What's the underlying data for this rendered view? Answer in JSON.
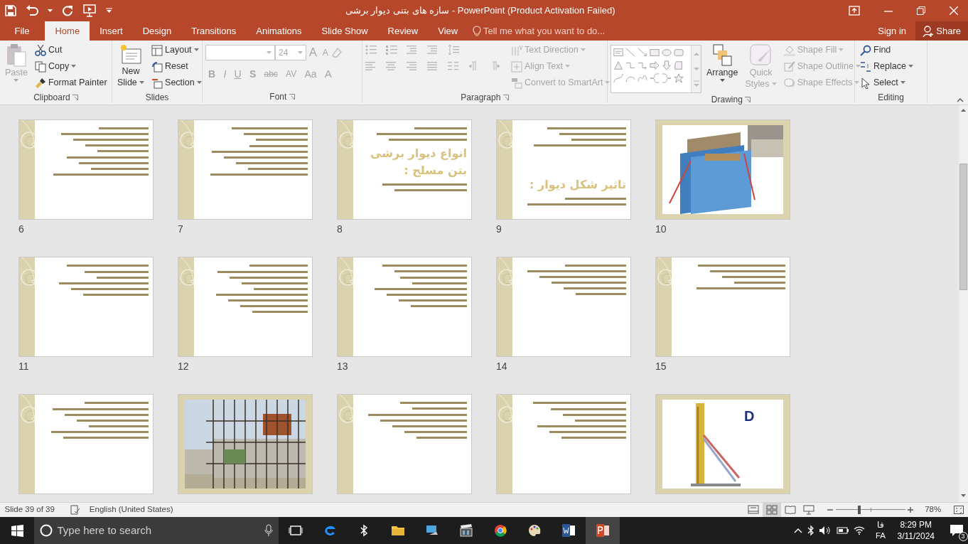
{
  "window": {
    "title": "سازه های بتنی دیوار برشی - PowerPoint (Product Activation Failed)"
  },
  "tabs": [
    {
      "label": "File",
      "selected": false
    },
    {
      "label": "Home",
      "selected": true
    },
    {
      "label": "Insert",
      "selected": false
    },
    {
      "label": "Design",
      "selected": false
    },
    {
      "label": "Transitions",
      "selected": false
    },
    {
      "label": "Animations",
      "selected": false
    },
    {
      "label": "Slide Show",
      "selected": false
    },
    {
      "label": "Review",
      "selected": false
    },
    {
      "label": "View",
      "selected": false
    }
  ],
  "tell_me": {
    "placeholder": "Tell me what you want to do..."
  },
  "account": {
    "sign_in": "Sign in",
    "share": "Share"
  },
  "ribbon": {
    "clipboard": {
      "label": "Clipboard",
      "paste": {
        "label": "Paste",
        "disabled": true
      },
      "items": [
        {
          "label": "Cut",
          "disabled": false
        },
        {
          "label": "Copy",
          "disabled": false
        },
        {
          "label": "Format Painter",
          "disabled": false
        }
      ]
    },
    "slides": {
      "label": "Slides",
      "new_slide": {
        "label": "New",
        "label_2": "Slide"
      },
      "items": [
        {
          "label": "Layout",
          "disabled": false
        },
        {
          "label": "Reset",
          "disabled": false
        },
        {
          "label": "Section",
          "disabled": false
        }
      ]
    },
    "font": {
      "label": "Font",
      "font_size": "24",
      "buttons": [
        "A",
        "A",
        "B",
        "I",
        "U",
        "S",
        "abc",
        "AV",
        "Aa",
        "A"
      ]
    },
    "paragraph": {
      "label": "Paragraph",
      "items": [
        {
          "label": "Text Direction",
          "disabled": true
        },
        {
          "label": "Align Text",
          "disabled": true
        },
        {
          "label": "Convert to SmartArt",
          "disabled": true
        }
      ]
    },
    "drawing": {
      "label": "Drawing",
      "arrange": {
        "label": "Arrange",
        "disabled": false
      },
      "quick_styles": {
        "label": "Quick",
        "label_2": "Styles",
        "disabled": true
      },
      "items": [
        {
          "label": "Shape Fill",
          "disabled": true
        },
        {
          "label": "Shape Outline",
          "disabled": true
        },
        {
          "label": "Shape Effects",
          "disabled": true
        }
      ]
    },
    "editing": {
      "label": "Editing",
      "items": [
        {
          "label": "Find",
          "disabled": false
        },
        {
          "label": "Replace",
          "disabled": false
        },
        {
          "label": "Select",
          "disabled": false
        }
      ]
    }
  },
  "slides": [
    {
      "number": "6",
      "kind": "text"
    },
    {
      "number": "7",
      "kind": "text"
    },
    {
      "number": "8",
      "kind": "text",
      "title": "انواع دیوار برشی بتن مسلح :"
    },
    {
      "number": "9",
      "kind": "text",
      "title": "تاثیر شکل دیوار :"
    },
    {
      "number": "10",
      "kind": "picture"
    },
    {
      "number": "11",
      "kind": "text"
    },
    {
      "number": "12",
      "kind": "text"
    },
    {
      "number": "13",
      "kind": "text"
    },
    {
      "number": "14",
      "kind": "text"
    },
    {
      "number": "15",
      "kind": "text"
    },
    {
      "kind": "text"
    },
    {
      "kind": "picture"
    },
    {
      "kind": "text"
    },
    {
      "kind": "text"
    },
    {
      "kind": "picture",
      "label": "D"
    }
  ],
  "status_bar": {
    "slide": "Slide 39 of 39",
    "language": "English (United States)",
    "views": [
      {
        "selected": false
      },
      {
        "selected": true
      },
      {
        "selected": false
      },
      {
        "selected": false
      }
    ],
    "zoom": {
      "level": 0.34,
      "reading": "78%"
    }
  },
  "taskbar": {
    "search": {
      "placeholder": "Type here to search"
    },
    "apps": [
      {
        "selected": false
      },
      {
        "selected": false
      },
      {
        "selected": false
      },
      {
        "selected": false
      },
      {
        "selected": false
      },
      {
        "selected": false
      },
      {
        "selected": false
      },
      {
        "selected": false
      },
      {
        "selected": true
      }
    ],
    "input_lang": "فا",
    "input_code": "FA",
    "time": "8:29 PM",
    "date": "3/11/2024",
    "notifications": "3"
  }
}
